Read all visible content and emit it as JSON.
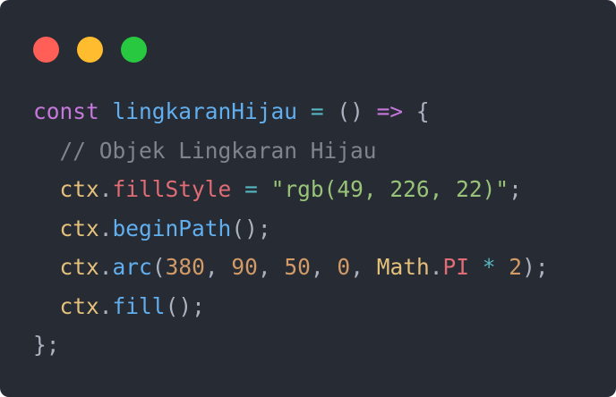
{
  "window": {
    "dots": [
      {
        "name": "close",
        "color": "#ff5f57"
      },
      {
        "name": "minimize",
        "color": "#febc2e"
      },
      {
        "name": "maximize",
        "color": "#28c840"
      }
    ]
  },
  "code": {
    "lines": [
      [
        {
          "t": "const",
          "c": "kw"
        },
        {
          "t": " ",
          "c": "pn"
        },
        {
          "t": "lingkaranHijau",
          "c": "fn"
        },
        {
          "t": " ",
          "c": "pn"
        },
        {
          "t": "=",
          "c": "op"
        },
        {
          "t": " () ",
          "c": "pn"
        },
        {
          "t": "=>",
          "c": "kw"
        },
        {
          "t": " {",
          "c": "pn"
        }
      ],
      [
        {
          "t": "  // Objek Lingkaran Hijau",
          "c": "cm"
        }
      ],
      [
        {
          "t": "  ",
          "c": "pn"
        },
        {
          "t": "ctx",
          "c": "obj"
        },
        {
          "t": ".",
          "c": "pn"
        },
        {
          "t": "fillStyle",
          "c": "prop"
        },
        {
          "t": " ",
          "c": "pn"
        },
        {
          "t": "=",
          "c": "op"
        },
        {
          "t": " ",
          "c": "pn"
        },
        {
          "t": "\"rgb(49, 226, 22)\"",
          "c": "str"
        },
        {
          "t": ";",
          "c": "pn"
        }
      ],
      [
        {
          "t": "  ",
          "c": "pn"
        },
        {
          "t": "ctx",
          "c": "obj"
        },
        {
          "t": ".",
          "c": "pn"
        },
        {
          "t": "beginPath",
          "c": "fn"
        },
        {
          "t": "();",
          "c": "pn"
        }
      ],
      [
        {
          "t": "  ",
          "c": "pn"
        },
        {
          "t": "ctx",
          "c": "obj"
        },
        {
          "t": ".",
          "c": "pn"
        },
        {
          "t": "arc",
          "c": "fn"
        },
        {
          "t": "(",
          "c": "pn"
        },
        {
          "t": "380",
          "c": "num"
        },
        {
          "t": ", ",
          "c": "pn"
        },
        {
          "t": "90",
          "c": "num"
        },
        {
          "t": ", ",
          "c": "pn"
        },
        {
          "t": "50",
          "c": "num"
        },
        {
          "t": ", ",
          "c": "pn"
        },
        {
          "t": "0",
          "c": "num"
        },
        {
          "t": ", ",
          "c": "pn"
        },
        {
          "t": "Math",
          "c": "obj"
        },
        {
          "t": ".",
          "c": "pn"
        },
        {
          "t": "PI",
          "c": "prop"
        },
        {
          "t": " ",
          "c": "pn"
        },
        {
          "t": "*",
          "c": "op"
        },
        {
          "t": " ",
          "c": "pn"
        },
        {
          "t": "2",
          "c": "num"
        },
        {
          "t": ");",
          "c": "pn"
        }
      ],
      [
        {
          "t": "  ",
          "c": "pn"
        },
        {
          "t": "ctx",
          "c": "obj"
        },
        {
          "t": ".",
          "c": "pn"
        },
        {
          "t": "fill",
          "c": "fn"
        },
        {
          "t": "();",
          "c": "pn"
        }
      ],
      [
        {
          "t": "};",
          "c": "pn"
        }
      ]
    ]
  }
}
